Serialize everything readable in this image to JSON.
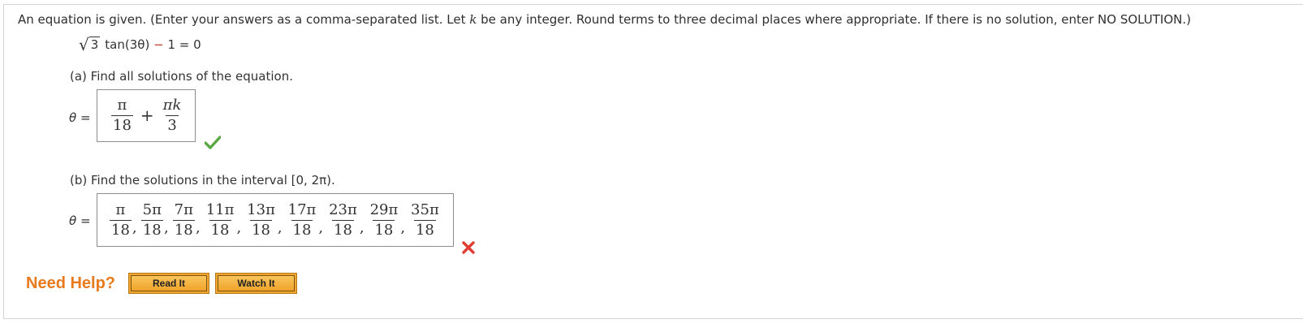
{
  "instructions": {
    "part1": "An equation is given. (Enter your answers as a comma-separated list. Let ",
    "var_k": "k",
    "part2": " be any integer. Round terms to three decimal places where appropriate. If there is no solution, enter NO SOLUTION.)"
  },
  "equation": {
    "sqrt_content": "3",
    "expr": "tan(3θ)",
    "op": "−",
    "rest": "1 = 0"
  },
  "part_a": {
    "question": "(a) Find all solutions of the equation.",
    "label": "θ",
    "equals": "=",
    "answer": {
      "t1_num": "π",
      "t1_den": "18",
      "plus": "+",
      "t2_num": "πk",
      "t2_den": "3"
    },
    "status": "correct"
  },
  "part_b": {
    "question": "(b) Find the solutions in the interval [0, 2π).",
    "label": "θ",
    "equals": "=",
    "answers": [
      {
        "num": "π",
        "den": "18"
      },
      {
        "num": "5π",
        "den": "18"
      },
      {
        "num": "7π",
        "den": "18"
      },
      {
        "num": "11π",
        "den": "18"
      },
      {
        "num": "13π",
        "den": "18"
      },
      {
        "num": "17π",
        "den": "18"
      },
      {
        "num": "23π",
        "den": "18"
      },
      {
        "num": "29π",
        "den": "18"
      },
      {
        "num": "35π",
        "den": "18"
      }
    ],
    "separator": ",",
    "status": "incorrect"
  },
  "help": {
    "label": "Need Help?",
    "read_it": "Read It",
    "watch_it": "Watch It"
  },
  "colors": {
    "check": "#5aa843",
    "cross": "#e03c31",
    "help_text": "#e87a1e",
    "button": "#f3a62d"
  }
}
